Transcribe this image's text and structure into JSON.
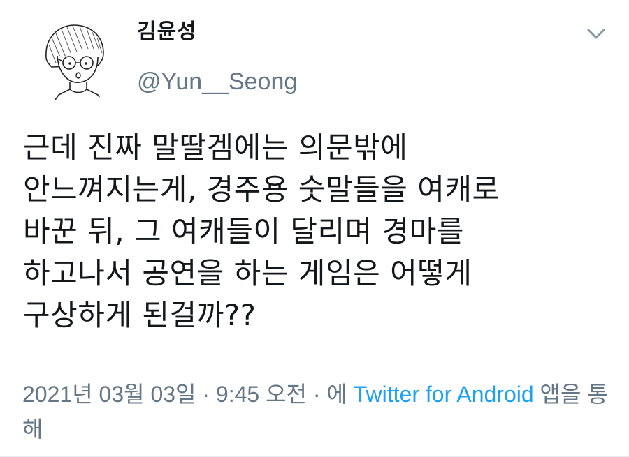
{
  "tweet": {
    "author": {
      "display_name": "김윤성",
      "handle": "@Yun__Seong",
      "avatar_icon": "cartoon-avatar-icon"
    },
    "menu_icon": "chevron-down-icon",
    "text": "근데 진짜 말딸겜에는 의문밖에\n안느껴지는게, 경주용 숫말들을 여캐로\n바꾼 뒤, 그 여캐들이 달리며 경마를\n하고나서 공연을 하는 게임은 어떻게\n구상하게 된걸까??",
    "meta": {
      "date": "2021년 03월 03일",
      "separator": " · ",
      "time": "9:45 오전",
      "source_prefix": "에 ",
      "source_link": "Twitter for Android",
      "source_suffix": " 앱을 통해"
    },
    "colors": {
      "text": "#14171a",
      "secondary": "#657786",
      "link": "#1da1f2"
    }
  }
}
